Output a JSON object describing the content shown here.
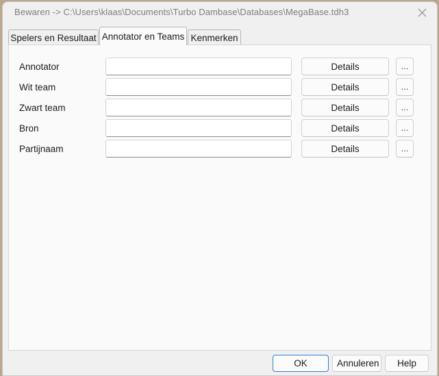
{
  "window": {
    "title": "Bewaren -> C:\\Users\\klaas\\Documents\\Turbo Dambase\\Databases\\MegaBase.tdh3",
    "close_icon": "close-icon"
  },
  "tabs": [
    {
      "label": "Spelers en Resultaat",
      "active": false
    },
    {
      "label": "Annotator en Teams",
      "active": true
    },
    {
      "label": "Kenmerken",
      "active": false
    }
  ],
  "form": {
    "rows": [
      {
        "label": "Annotator",
        "value": "",
        "placeholder": "",
        "details_label": "Details",
        "ellipsis_label": "..."
      },
      {
        "label": "Wit team",
        "value": "",
        "placeholder": "",
        "details_label": "Details",
        "ellipsis_label": "..."
      },
      {
        "label": "Zwart team",
        "value": "",
        "placeholder": "",
        "details_label": "Details",
        "ellipsis_label": "..."
      },
      {
        "label": "Bron",
        "value": "",
        "placeholder": "",
        "details_label": "Details",
        "ellipsis_label": "..."
      },
      {
        "label": "Partijnaam",
        "value": "",
        "placeholder": "",
        "details_label": "Details",
        "ellipsis_label": "..."
      }
    ]
  },
  "footer": {
    "ok_label": "OK",
    "cancel_label": "Annuleren",
    "help_label": "Help"
  },
  "colors": {
    "window_background": "#f0f0f0",
    "panel_background": "#fafafa",
    "title_text": "#7d7d7d",
    "body_text": "#1a1a1a",
    "focus_accent": "#2a7fd4",
    "desktop": "#b9a68f"
  }
}
